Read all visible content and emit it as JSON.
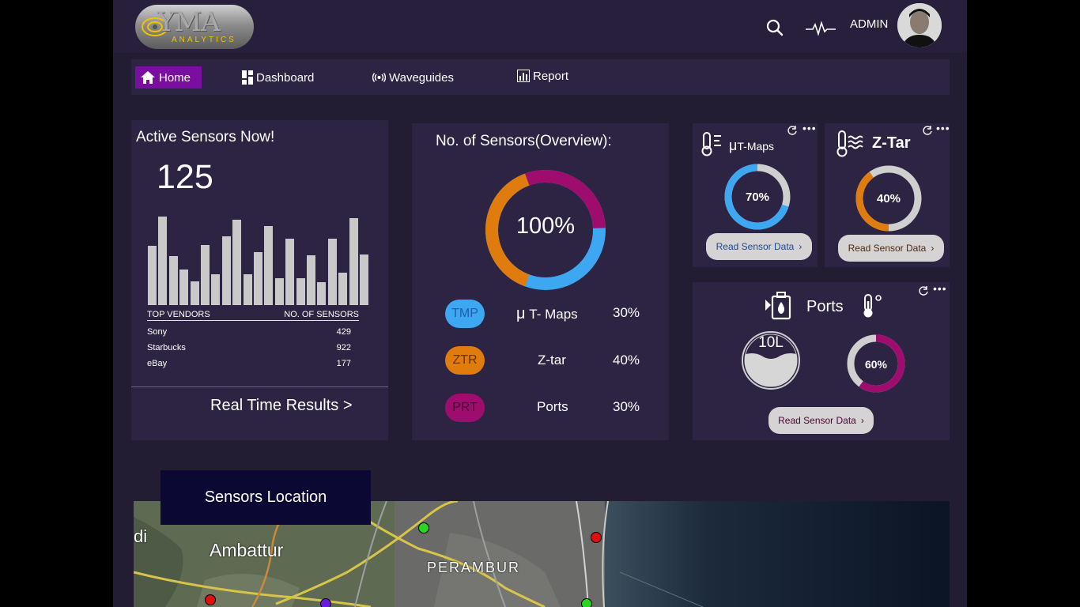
{
  "header": {
    "logo_text": "YMA",
    "logo_sub": "ANALYTICS",
    "user_name": "ADMIN"
  },
  "nav": {
    "home": "Home",
    "dashboard": "Dashboard",
    "waveguides": "Waveguides",
    "report": "Report"
  },
  "active_sensors": {
    "title": "Active Sensors Now!",
    "count": "125",
    "bar_values": [
      0.67,
      1.0,
      0.55,
      0.4,
      0.27,
      0.68,
      0.35,
      0.78,
      0.96,
      0.35,
      0.6,
      0.89,
      0.3,
      0.75,
      0.3,
      0.56,
      0.26,
      0.75,
      0.37,
      0.98,
      0.57
    ],
    "table": {
      "col1": "TOP VENDORS",
      "col2": "NO. OF SENSORS",
      "rows": [
        {
          "vendor": "Sony",
          "count": "429"
        },
        {
          "vendor": "Starbucks",
          "count": "922"
        },
        {
          "vendor": "eBay",
          "count": "177"
        }
      ]
    },
    "link": "Real Time Results  >"
  },
  "overview": {
    "title": "No. of Sensors(Overview):",
    "center": "100%",
    "rows": [
      {
        "tag": "TMP",
        "name": "T- Maps",
        "prefix": "μ",
        "pct": "30%",
        "color": "#3ea7f2",
        "textcolor": "#1d5fa8"
      },
      {
        "tag": "ZTR",
        "name": "Z-tar",
        "prefix": "",
        "pct": "40%",
        "color": "#e07c0d",
        "textcolor": "#6a3300"
      },
      {
        "tag": "PRT",
        "name": "Ports",
        "prefix": "",
        "pct": "30%",
        "color": "#9e0d6e",
        "textcolor": "#4a0533"
      }
    ]
  },
  "tmaps": {
    "prefix": "μ",
    "title": "T-Maps",
    "value": "70%",
    "value_num": 70,
    "button": "Read Sensor Data",
    "color": "#3ea7f2"
  },
  "ztar": {
    "title": "Z-Tar",
    "value": "40%",
    "value_num": 40,
    "button": "Read Sensor Data",
    "color": "#e07c0d"
  },
  "ports": {
    "title": "Ports",
    "tank": "10L",
    "value": "60%",
    "value_num": 60,
    "button": "Read Sensor Data",
    "color": "#9e0d6e"
  },
  "map": {
    "label": "Sensors Location",
    "places": [
      "di",
      "Ambattur",
      "PERAMBUR"
    ]
  },
  "colors": {
    "background": "#221d33",
    "panel": "#2c2442",
    "accent": "#7a0ea0",
    "sensor_ok": "#2bd61f",
    "sensor_alert": "#e01010",
    "sensor_other": "#6a1be0"
  }
}
